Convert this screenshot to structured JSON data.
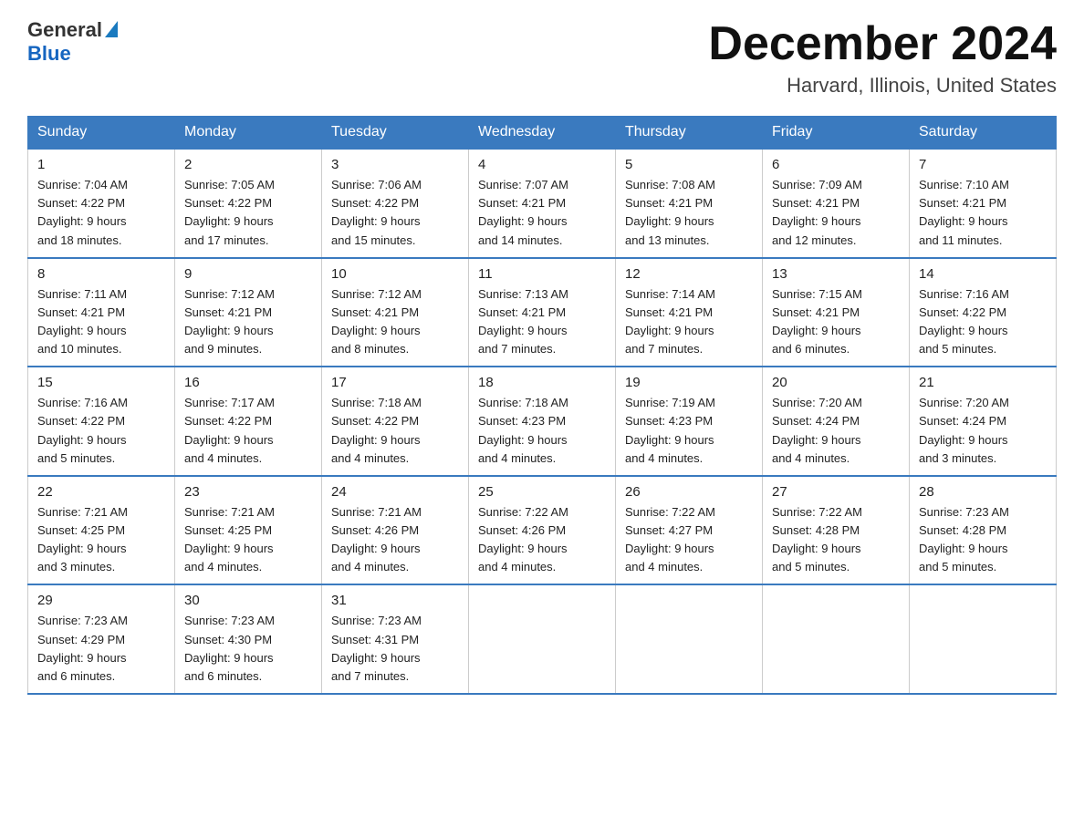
{
  "header": {
    "logo_general": "General",
    "logo_blue": "Blue",
    "main_title": "December 2024",
    "subtitle": "Harvard, Illinois, United States"
  },
  "days_of_week": [
    "Sunday",
    "Monday",
    "Tuesday",
    "Wednesday",
    "Thursday",
    "Friday",
    "Saturday"
  ],
  "weeks": [
    [
      {
        "day": "1",
        "sunrise": "7:04 AM",
        "sunset": "4:22 PM",
        "daylight": "9 hours and 18 minutes."
      },
      {
        "day": "2",
        "sunrise": "7:05 AM",
        "sunset": "4:22 PM",
        "daylight": "9 hours and 17 minutes."
      },
      {
        "day": "3",
        "sunrise": "7:06 AM",
        "sunset": "4:22 PM",
        "daylight": "9 hours and 15 minutes."
      },
      {
        "day": "4",
        "sunrise": "7:07 AM",
        "sunset": "4:21 PM",
        "daylight": "9 hours and 14 minutes."
      },
      {
        "day": "5",
        "sunrise": "7:08 AM",
        "sunset": "4:21 PM",
        "daylight": "9 hours and 13 minutes."
      },
      {
        "day": "6",
        "sunrise": "7:09 AM",
        "sunset": "4:21 PM",
        "daylight": "9 hours and 12 minutes."
      },
      {
        "day": "7",
        "sunrise": "7:10 AM",
        "sunset": "4:21 PM",
        "daylight": "9 hours and 11 minutes."
      }
    ],
    [
      {
        "day": "8",
        "sunrise": "7:11 AM",
        "sunset": "4:21 PM",
        "daylight": "9 hours and 10 minutes."
      },
      {
        "day": "9",
        "sunrise": "7:12 AM",
        "sunset": "4:21 PM",
        "daylight": "9 hours and 9 minutes."
      },
      {
        "day": "10",
        "sunrise": "7:12 AM",
        "sunset": "4:21 PM",
        "daylight": "9 hours and 8 minutes."
      },
      {
        "day": "11",
        "sunrise": "7:13 AM",
        "sunset": "4:21 PM",
        "daylight": "9 hours and 7 minutes."
      },
      {
        "day": "12",
        "sunrise": "7:14 AM",
        "sunset": "4:21 PM",
        "daylight": "9 hours and 7 minutes."
      },
      {
        "day": "13",
        "sunrise": "7:15 AM",
        "sunset": "4:21 PM",
        "daylight": "9 hours and 6 minutes."
      },
      {
        "day": "14",
        "sunrise": "7:16 AM",
        "sunset": "4:22 PM",
        "daylight": "9 hours and 5 minutes."
      }
    ],
    [
      {
        "day": "15",
        "sunrise": "7:16 AM",
        "sunset": "4:22 PM",
        "daylight": "9 hours and 5 minutes."
      },
      {
        "day": "16",
        "sunrise": "7:17 AM",
        "sunset": "4:22 PM",
        "daylight": "9 hours and 4 minutes."
      },
      {
        "day": "17",
        "sunrise": "7:18 AM",
        "sunset": "4:22 PM",
        "daylight": "9 hours and 4 minutes."
      },
      {
        "day": "18",
        "sunrise": "7:18 AM",
        "sunset": "4:23 PM",
        "daylight": "9 hours and 4 minutes."
      },
      {
        "day": "19",
        "sunrise": "7:19 AM",
        "sunset": "4:23 PM",
        "daylight": "9 hours and 4 minutes."
      },
      {
        "day": "20",
        "sunrise": "7:20 AM",
        "sunset": "4:24 PM",
        "daylight": "9 hours and 4 minutes."
      },
      {
        "day": "21",
        "sunrise": "7:20 AM",
        "sunset": "4:24 PM",
        "daylight": "9 hours and 3 minutes."
      }
    ],
    [
      {
        "day": "22",
        "sunrise": "7:21 AM",
        "sunset": "4:25 PM",
        "daylight": "9 hours and 3 minutes."
      },
      {
        "day": "23",
        "sunrise": "7:21 AM",
        "sunset": "4:25 PM",
        "daylight": "9 hours and 4 minutes."
      },
      {
        "day": "24",
        "sunrise": "7:21 AM",
        "sunset": "4:26 PM",
        "daylight": "9 hours and 4 minutes."
      },
      {
        "day": "25",
        "sunrise": "7:22 AM",
        "sunset": "4:26 PM",
        "daylight": "9 hours and 4 minutes."
      },
      {
        "day": "26",
        "sunrise": "7:22 AM",
        "sunset": "4:27 PM",
        "daylight": "9 hours and 4 minutes."
      },
      {
        "day": "27",
        "sunrise": "7:22 AM",
        "sunset": "4:28 PM",
        "daylight": "9 hours and 5 minutes."
      },
      {
        "day": "28",
        "sunrise": "7:23 AM",
        "sunset": "4:28 PM",
        "daylight": "9 hours and 5 minutes."
      }
    ],
    [
      {
        "day": "29",
        "sunrise": "7:23 AM",
        "sunset": "4:29 PM",
        "daylight": "9 hours and 6 minutes."
      },
      {
        "day": "30",
        "sunrise": "7:23 AM",
        "sunset": "4:30 PM",
        "daylight": "9 hours and 6 minutes."
      },
      {
        "day": "31",
        "sunrise": "7:23 AM",
        "sunset": "4:31 PM",
        "daylight": "9 hours and 7 minutes."
      },
      null,
      null,
      null,
      null
    ]
  ],
  "labels": {
    "sunrise": "Sunrise:",
    "sunset": "Sunset:",
    "daylight": "Daylight:"
  }
}
